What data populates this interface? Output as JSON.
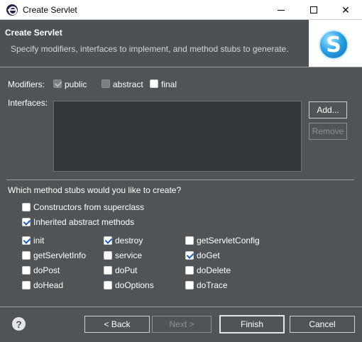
{
  "window": {
    "title": "Create Servlet"
  },
  "header": {
    "title": "Create Servlet",
    "description": "Specify modifiers, interfaces to implement, and method stubs to generate."
  },
  "modifiers": {
    "label": "Modifiers:",
    "public": {
      "label": "public",
      "checked": true,
      "enabled": false
    },
    "abstract": {
      "label": "abstract",
      "checked": false,
      "enabled": false
    },
    "final": {
      "label": "final",
      "checked": false,
      "enabled": true
    }
  },
  "interfaces": {
    "label": "Interfaces:",
    "add_label": "Add...",
    "remove_label": "Remove"
  },
  "stubs": {
    "question": "Which method stubs would you like to create?",
    "constructors": {
      "label": "Constructors from superclass",
      "checked": false
    },
    "inherited": {
      "label": "Inherited abstract methods",
      "checked": true
    },
    "methods": [
      {
        "label": "init",
        "checked": true
      },
      {
        "label": "destroy",
        "checked": true
      },
      {
        "label": "getServletConfig",
        "checked": false
      },
      {
        "label": "getServletInfo",
        "checked": false
      },
      {
        "label": "service",
        "checked": false
      },
      {
        "label": "doGet",
        "checked": true
      },
      {
        "label": "doPost",
        "checked": false
      },
      {
        "label": "doPut",
        "checked": false
      },
      {
        "label": "doDelete",
        "checked": false
      },
      {
        "label": "doHead",
        "checked": false
      },
      {
        "label": "doOptions",
        "checked": false
      },
      {
        "label": "doTrace",
        "checked": false
      }
    ]
  },
  "footer": {
    "back_label": "< Back",
    "next_label": "Next >",
    "finish_label": "Finish",
    "cancel_label": "Cancel",
    "help_symbol": "?"
  },
  "colors": {
    "dialog_bg": "#505457",
    "header_bg": "#4d5154",
    "check_accent": "#1a5fb4"
  }
}
